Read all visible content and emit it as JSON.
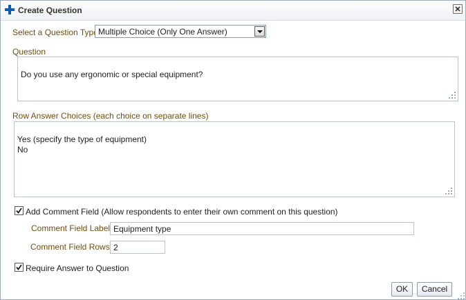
{
  "dialog": {
    "title": "Create Question",
    "close_icon": "close-icon",
    "accent_color": "#0a5cb5"
  },
  "question_type": {
    "label": "Select a Question Type",
    "selected": "Multiple Choice (Only One Answer)"
  },
  "question": {
    "label": "Question",
    "value": "Do you use any ergonomic or special equipment?"
  },
  "answers": {
    "label": "Row Answer Choices (each choice on separate lines)",
    "value": "Yes (specify the type of equipment)\nNo"
  },
  "comment": {
    "checkbox_label": "Add Comment Field (Allow respondents to enter their own comment on this question)",
    "checked": true,
    "field_label_caption": "Comment Field Label",
    "field_label_value": "Equipment type",
    "rows_caption": "Comment Field Rows",
    "rows_value": "2"
  },
  "require": {
    "label": "Require Answer to Question",
    "checked": true
  },
  "buttons": {
    "ok": "OK",
    "cancel": "Cancel"
  }
}
